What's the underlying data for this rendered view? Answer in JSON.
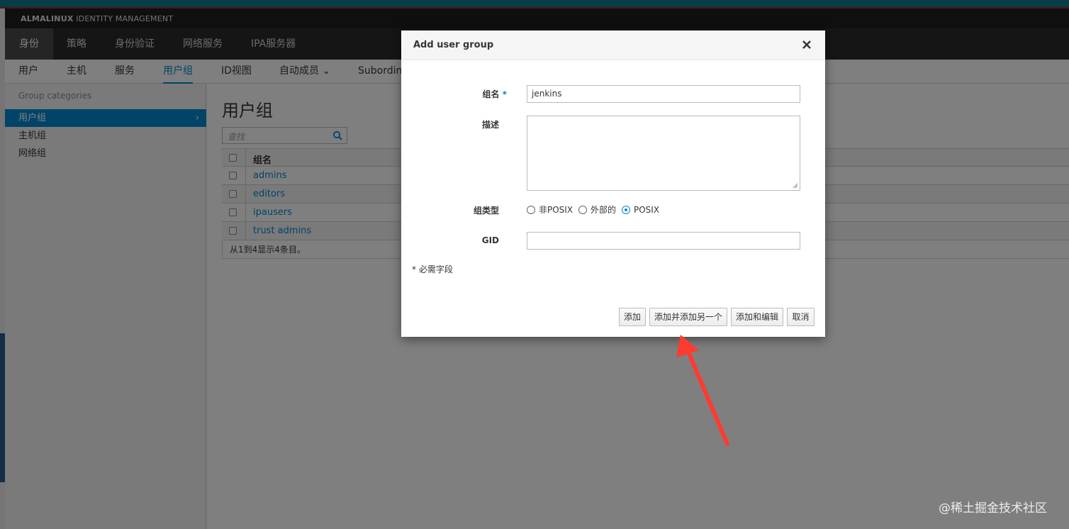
{
  "app": {
    "brand_bold": "ALMALINUX",
    "brand_rest": " IDENTITY MANAGEMENT"
  },
  "main_nav": [
    "身份",
    "策略",
    "身份验证",
    "网络服务",
    "IPA服务器"
  ],
  "sub_nav": {
    "items": [
      "用户",
      "主机",
      "服务",
      "用户组",
      "ID视图",
      "自动成员 ⌄",
      "Subordin"
    ],
    "active": "用户组"
  },
  "sidebar": {
    "category_label": "Group categories",
    "items": [
      "用户组",
      "主机组",
      "网络组"
    ],
    "active_chevron": "›"
  },
  "content": {
    "title": "用户组",
    "search_placeholder": "查找",
    "table": {
      "header": "组名",
      "rows": [
        "admins",
        "editors",
        "ipausers",
        "trust admins"
      ],
      "footer": "从1到4显示4条目。"
    }
  },
  "modal": {
    "title": "Add user group",
    "fields": {
      "name_label": "组名",
      "required_mark": "*",
      "name_value": "jenkins",
      "description_label": "描述",
      "group_type_label": "组类型",
      "group_type_options": [
        "非POSIX",
        "外部的",
        "POSIX"
      ],
      "group_type_selected": "POSIX",
      "gid_label": "GID"
    },
    "required_note": "* 必需字段",
    "buttons": {
      "add": "添加",
      "add_another": "添加并添加另一个",
      "add_edit": "添加和编辑",
      "cancel": "取消"
    }
  },
  "watermark": "@稀土掘金技术社区",
  "colors": {
    "accent": "#0088ce",
    "annotation_arrow": "#ff3b30"
  }
}
